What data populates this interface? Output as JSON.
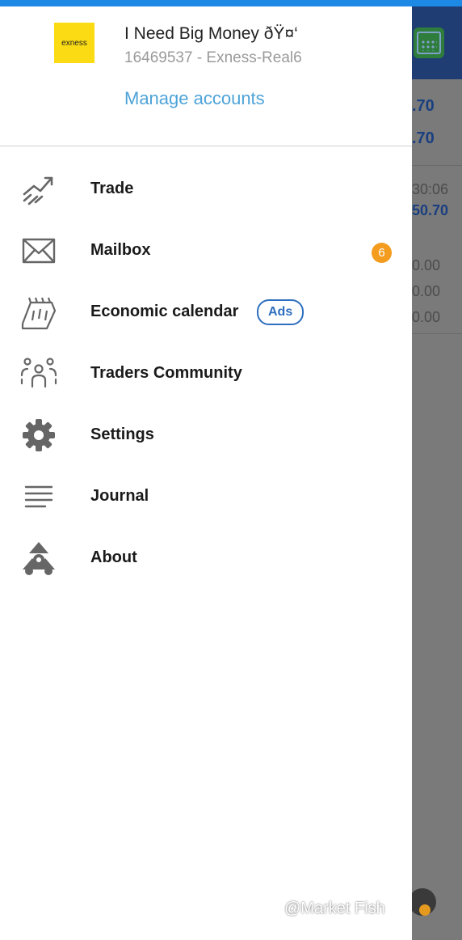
{
  "account": {
    "logo_text": "exness",
    "name": "I Need Big Money ðŸ¤‘",
    "id_server": "16469537 - Exness-Real6",
    "manage_label": "Manage accounts"
  },
  "menu": [
    {
      "label": "Trade",
      "icon": "trade-chart-icon"
    },
    {
      "label": "Mailbox",
      "icon": "mail-icon",
      "badge": "6"
    },
    {
      "label": "Economic calendar",
      "icon": "calendar-icon",
      "tag": "Ads"
    },
    {
      "label": "Traders Community",
      "icon": "community-icon"
    },
    {
      "label": "Settings",
      "icon": "gear-icon"
    },
    {
      "label": "Journal",
      "icon": "journal-lines-icon"
    },
    {
      "label": "About",
      "icon": "about-logo-icon"
    }
  ],
  "background": {
    "values": [
      ".70",
      ".70",
      "30:06",
      "50.70",
      "0.00",
      "0.00",
      "0.00"
    ]
  },
  "watermark": "@Market Fish"
}
